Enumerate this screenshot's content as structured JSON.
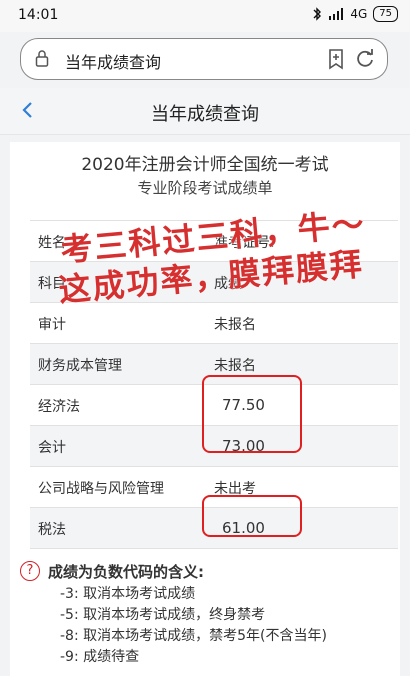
{
  "status": {
    "time": "14:01",
    "signal": "4G",
    "battery": "75"
  },
  "browser": {
    "url": "当年成绩查询"
  },
  "nav": {
    "title": "当年成绩查询"
  },
  "doc": {
    "title1": "2020年注册会计师全国统一考试",
    "title2": "专业阶段考试成绩单"
  },
  "table": {
    "rows": [
      {
        "label": "姓名",
        "value": "准考证号:"
      },
      {
        "label": "科目",
        "value": "成绩"
      },
      {
        "label": "审计",
        "value": "未报名"
      },
      {
        "label": "财务成本管理",
        "value": "未报名"
      },
      {
        "label": "经济法",
        "value": "77.50"
      },
      {
        "label": "会计",
        "value": "73.00"
      },
      {
        "label": "公司战略与风险管理",
        "value": "未出考"
      },
      {
        "label": "税法",
        "value": "61.00"
      }
    ]
  },
  "overlay": {
    "line1": "考三科过三科，牛～",
    "line2": "这成功率，膜拜膜拜"
  },
  "notes": {
    "title": "成绩为负数代码的含义:",
    "items": [
      "-3: 取消本场考试成绩",
      "-5: 取消本场考试成绩，终身禁考",
      "-8: 取消本场考试成绩，禁考5年(不含当年)",
      "-9: 成绩待查"
    ]
  },
  "colors": {
    "highlight": "#e02020",
    "overlay_text": "#d62f2f"
  }
}
